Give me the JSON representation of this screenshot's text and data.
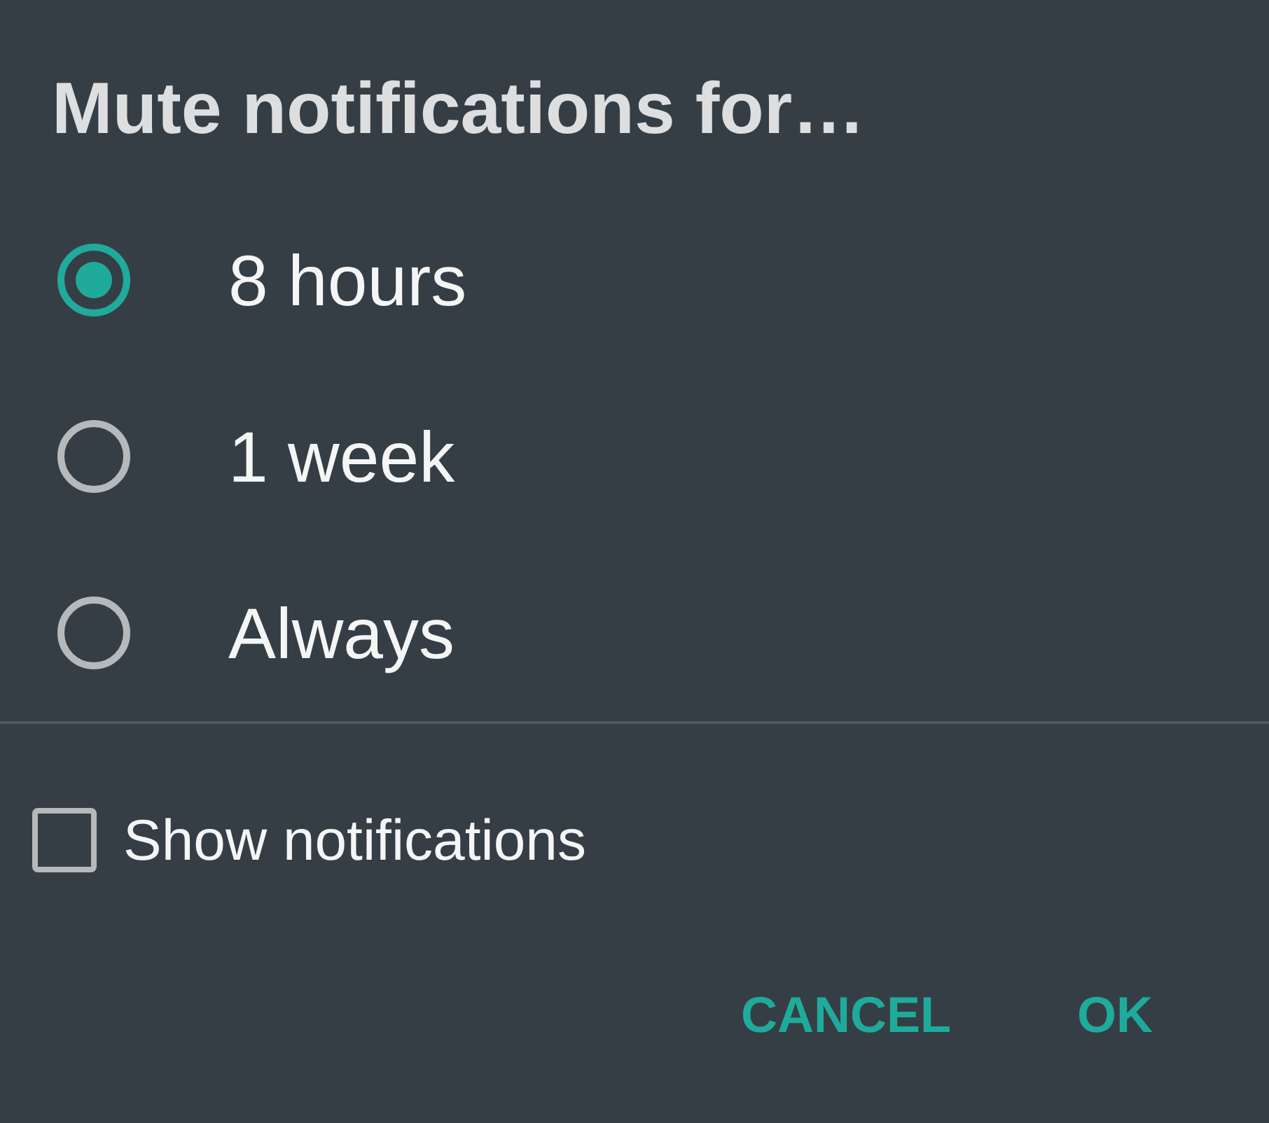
{
  "dialog": {
    "title": "Mute notifications for…"
  },
  "options": [
    {
      "label": "8 hours",
      "selected": true
    },
    {
      "label": "1 week",
      "selected": false
    },
    {
      "label": "Always",
      "selected": false
    }
  ],
  "show_notifications": {
    "label": "Show notifications",
    "checked": false
  },
  "buttons": [
    "CANCEL",
    "OK"
  ]
}
